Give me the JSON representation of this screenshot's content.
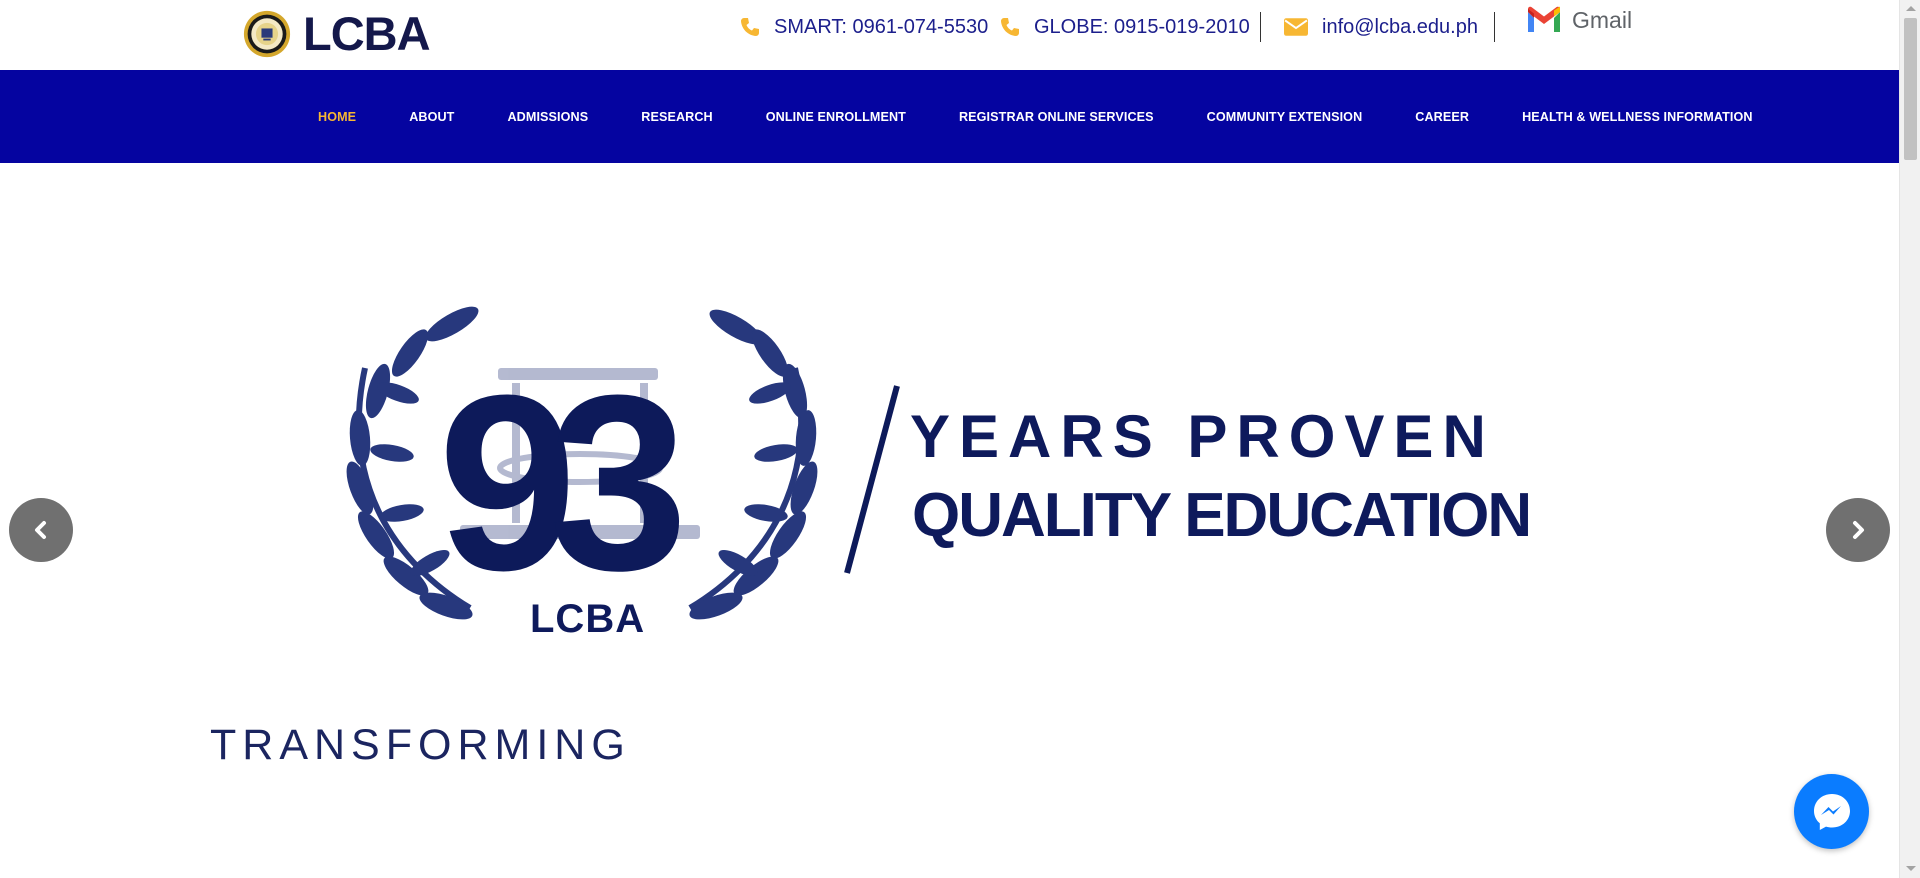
{
  "header": {
    "brand": "LCBA",
    "contacts": [
      {
        "icon": "phone-icon",
        "label": "SMART: 0961-074-5530"
      },
      {
        "icon": "phone-icon",
        "label": "GLOBE: 0915-019-2010"
      },
      {
        "icon": "envelope-icon",
        "label": "info@lcba.edu.ph"
      }
    ],
    "gmail_label": "Gmail"
  },
  "nav": {
    "items": [
      {
        "label": "HOME",
        "active": true
      },
      {
        "label": "ABOUT"
      },
      {
        "label": "ADMISSIONS"
      },
      {
        "label": "RESEARCH"
      },
      {
        "label": "ONLINE ENROLLMENT"
      },
      {
        "label": "REGISTRAR ONLINE SERVICES"
      },
      {
        "label": "COMMUNITY EXTENSION"
      },
      {
        "label": "CAREER"
      },
      {
        "label": "HEALTH & WELLNESS INFORMATION"
      }
    ]
  },
  "hero": {
    "number": "93",
    "line1": "YEARS PROVEN",
    "line2": "QUALITY EDUCATION",
    "wreath_label": "LCBA",
    "tagline": "TRANSFORMING"
  },
  "icons": {
    "prev": "chevron-left-icon",
    "next": "chevron-right-icon",
    "chat": "messenger-icon"
  },
  "colors": {
    "nav_bg": "#0504a0",
    "nav_active": "#f7b733",
    "contact_text": "#1c1f8c",
    "accent_icon": "#f7b733",
    "hero_navy": "#0e1a5c",
    "messenger_blue": "#0a7cff"
  }
}
